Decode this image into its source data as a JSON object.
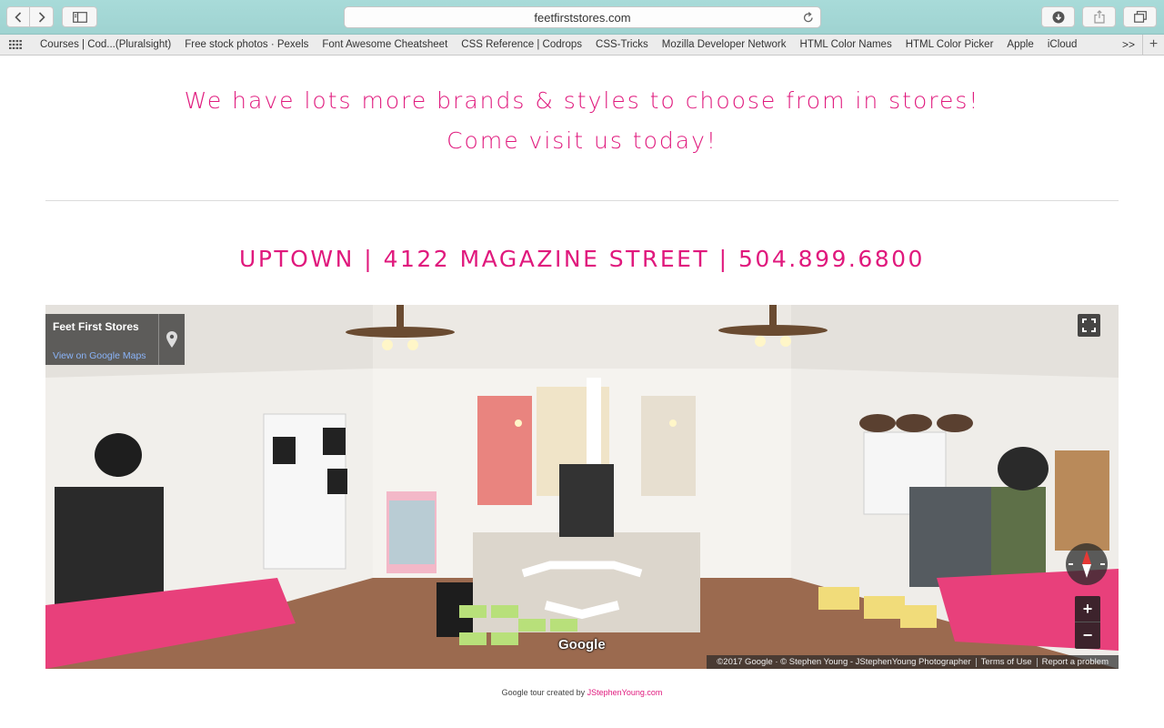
{
  "browser": {
    "address": "feetfirststores.com",
    "favorites": [
      "Courses | Cod...(Pluralsight)",
      "Free stock photos · Pexels",
      "Font Awesome Cheatsheet",
      "CSS Reference | Codrops",
      "CSS-Tricks",
      "Mozilla Developer Network",
      "HTML Color Names",
      "HTML Color Picker",
      "Apple",
      "iCloud"
    ],
    "favorites_more": ">>",
    "favorites_add": "+"
  },
  "page": {
    "promo_line1": "We have lots more brands & styles to choose from in stores!",
    "promo_line2": "Come visit us today!",
    "store_line": "UPTOWN | 4122 MAGAZINE STREET | 504.899.6800",
    "accent_color": "#e0197d"
  },
  "streetview": {
    "place_title": "Feet First Stores",
    "view_link": "View on Google Maps",
    "google_logo": "Google",
    "copyright": "©2017 Google · © Stephen Young - JStephenYoung Photographer",
    "terms": "Terms of Use",
    "report": "Report a problem",
    "zoom_in": "+",
    "zoom_out": "−"
  },
  "credit": {
    "prefix": "Google tour created by ",
    "link": "JStephenYoung.com"
  }
}
